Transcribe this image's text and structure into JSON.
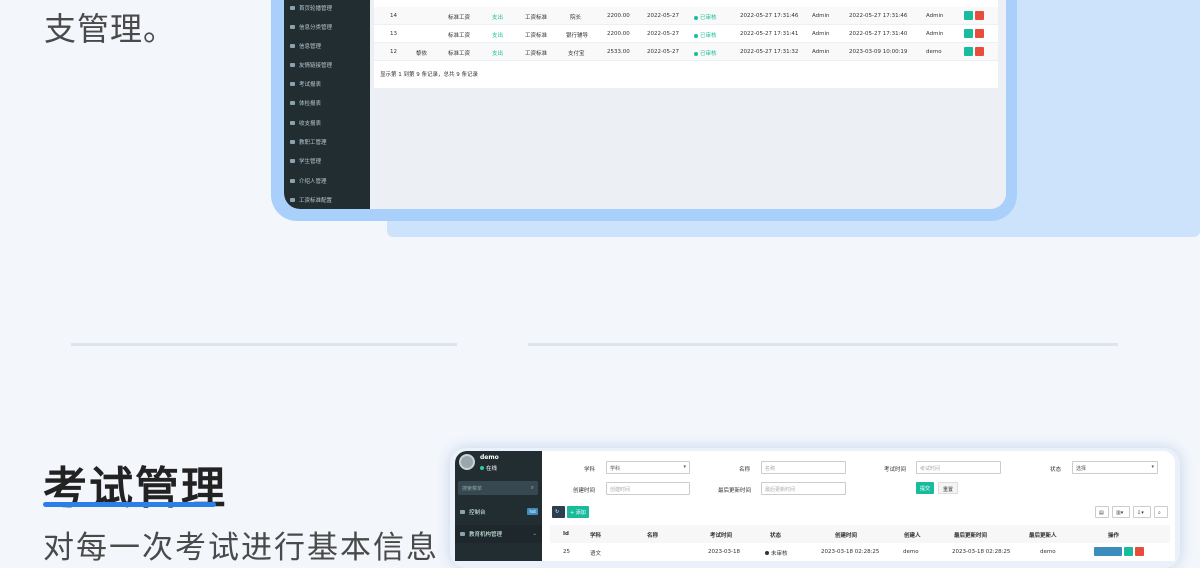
{
  "top": {
    "heading_tail": "支管理。",
    "sidebar": [
      "首页轮播管理",
      "信息分类管理",
      "信息管理",
      "友情链接管理",
      "考试报表",
      "体检报表",
      "收支报表",
      "教职工管理",
      "学生管理",
      "介绍人管理",
      "工资标准配置"
    ],
    "rows": [
      {
        "id": "14",
        "name": "",
        "type": "标准工资",
        "dir": "支出",
        "std": "工资标准",
        "item": "院长",
        "amount": "2200.00",
        "date": "2022-05-27",
        "status": "已审核",
        "created": "2022-05-27 17:31:46",
        "creator": "Admin",
        "updated": "2022-05-27 17:31:46",
        "updater": "Admin"
      },
      {
        "id": "13",
        "name": "",
        "type": "标准工资",
        "dir": "支出",
        "std": "工资标准",
        "item": "银行辅导",
        "amount": "2200.00",
        "date": "2022-05-27",
        "status": "已审核",
        "created": "2022-05-27 17:31:41",
        "creator": "Admin",
        "updated": "2022-05-27 17:31:40",
        "updater": "Admin"
      },
      {
        "id": "12",
        "name": "黎依",
        "type": "标准工资",
        "dir": "支出",
        "std": "工资标准",
        "item": "支付宝",
        "amount": "2533.00",
        "date": "2022-05-27",
        "status": "已审核",
        "created": "2022-05-27 17:31:32",
        "creator": "Admin",
        "updated": "2023-03-09 10:00:19",
        "updater": "demo"
      }
    ],
    "table_info": "显示第 1 到第 9 条记录，总共 9 条记录"
  },
  "bottom": {
    "title": "考试管理",
    "subtitle": "对每一次考试进行基本信息",
    "user": {
      "name": "demo",
      "status": "在线"
    },
    "search_placeholder": "搜索菜单",
    "menu": [
      {
        "label": "控制台",
        "badge": "hot"
      },
      {
        "label": "教育机构管理",
        "badge": ""
      }
    ],
    "filters": {
      "subject_label": "学科",
      "subject_value": "学科",
      "name_label": "名称",
      "name_ph": "名称",
      "exam_time_label": "考试时间",
      "exam_time_ph": "考试时间",
      "status_label": "状态",
      "status_value": "选择",
      "created_label": "创建时间",
      "created_ph": "创建时间",
      "updated_label": "最后更新时间",
      "updated_ph": "最后更新时间",
      "submit": "提交",
      "reset": "重置"
    },
    "toolbar": {
      "add": "+ 添加"
    },
    "columns": [
      "Id",
      "学科",
      "名称",
      "考试时间",
      "状态",
      "创建时间",
      "创建人",
      "最后更新时间",
      "最后更新人",
      "操作"
    ],
    "first_row": {
      "id": "25",
      "subject": "语文",
      "name": "",
      "exam_time": "2023-03-18",
      "status": "未审核",
      "created": "2023-03-18 02:28:25",
      "creator": "demo",
      "updated": "2023-03-18 02:28:25",
      "updater": "demo"
    }
  }
}
